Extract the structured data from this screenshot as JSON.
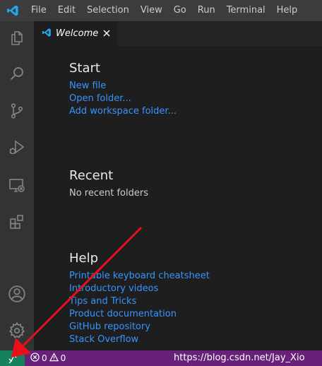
{
  "titlebar": {
    "logo_icon": "vscode-logo-icon",
    "menu": [
      "File",
      "Edit",
      "Selection",
      "View",
      "Go",
      "Run",
      "Terminal",
      "Help"
    ]
  },
  "activitybar": {
    "items": [
      "explorer-icon",
      "search-icon",
      "source-control-icon",
      "run-debug-icon",
      "remote-explorer-icon",
      "extensions-icon"
    ],
    "bottom_items": [
      "account-icon",
      "settings-gear-icon"
    ]
  },
  "tabs": [
    {
      "label": "Welcome",
      "active": true,
      "icon": "vscode-logo-icon"
    }
  ],
  "welcome": {
    "start": {
      "title": "Start",
      "links": [
        "New file",
        "Open folder...",
        "Add workspace folder..."
      ]
    },
    "recent": {
      "title": "Recent",
      "empty_text": "No recent folders"
    },
    "help": {
      "title": "Help",
      "links": [
        "Printable keyboard cheatsheet",
        "Introductory videos",
        "Tips and Tricks",
        "Product documentation",
        "GitHub repository",
        "Stack Overflow"
      ]
    }
  },
  "statusbar": {
    "remote_icon": "remote-indicator-icon",
    "errors": "0",
    "warnings": "0",
    "watermark": "https://blog.csdn.net/Jay_Xio"
  },
  "colors": {
    "titlebar": "#3c3c3c",
    "activitybar": "#333333",
    "editor": "#1e1e1e",
    "link": "#3794ff",
    "statusbar": "#68217a",
    "remote": "#16825d",
    "annotation_arrow": "#e8101a"
  }
}
